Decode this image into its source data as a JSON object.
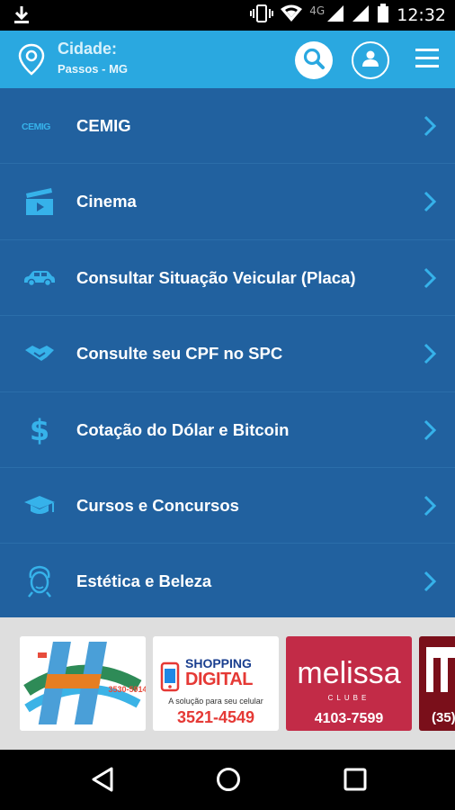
{
  "status_bar": {
    "time": "12:32",
    "network": "4G"
  },
  "header": {
    "city_label": "Cidade:",
    "city_value": "Passos - MG"
  },
  "menu": {
    "items": [
      {
        "label": "CEMIG",
        "icon": "cemig-logo-icon"
      },
      {
        "label": "Cinema",
        "icon": "clapperboard-icon"
      },
      {
        "label": "Consultar Situação Veicular (Placa)",
        "icon": "car-icon"
      },
      {
        "label": "Consulte seu CPF no SPC",
        "icon": "handshake-icon"
      },
      {
        "label": "Cotação do Dólar e Bitcoin",
        "icon": "dollar-icon"
      },
      {
        "label": "Cursos e Concursos",
        "icon": "graduation-cap-icon"
      },
      {
        "label": "Estética e Beleza",
        "icon": "beauty-face-icon"
      }
    ],
    "cemig_logo_text": "CEMIG"
  },
  "ads": {
    "ad1": {
      "phone": "3530-5914"
    },
    "ad2": {
      "title_top": "SHOPPING",
      "title_bottom": "DIGITAL",
      "tagline": "A solução para seu celular",
      "phone": "3521-4549"
    },
    "ad3": {
      "brand": "melissa",
      "sub": "CLUBE",
      "phone": "4103-7599"
    },
    "ad4": {
      "phone": "(35)"
    }
  },
  "colors": {
    "header": "#2aa8e0",
    "list_bg": "#21619f",
    "accent": "#36b2ea"
  }
}
